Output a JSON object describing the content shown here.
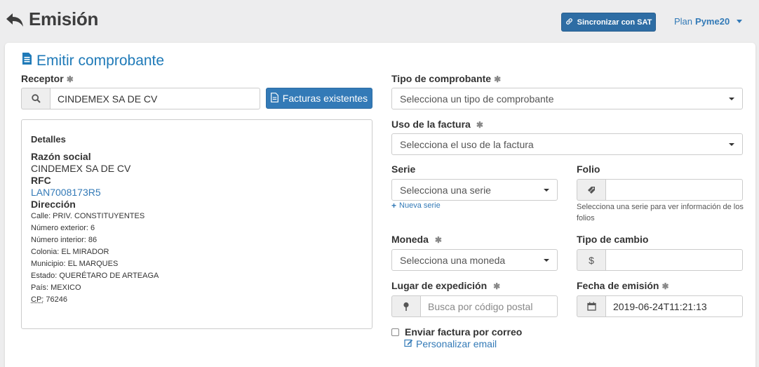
{
  "header": {
    "title": "Emisión",
    "sync_button": "Sincronizar con SAT",
    "plan_label": "Plan",
    "plan_name": "Pyme20"
  },
  "form": {
    "title": "Emitir comprobante",
    "receptor": {
      "label": "Receptor",
      "value": "CINDEMEX SA DE CV",
      "facturas_button": "Facturas existentes"
    },
    "details": {
      "title": "Detalles",
      "razon_label": "Razón social",
      "razon_value": "CINDEMEX SA DE CV",
      "rfc_label": "RFC",
      "rfc_value": "LAN7008173R5",
      "direccion_label": "Dirección",
      "lines": [
        "Calle: PRIV. CONSTITUYENTES",
        "Número exterior: 6",
        "Número interior: 86",
        "Colonia: EL MIRADOR",
        "Municipio: EL MARQUES",
        "Estado: QUERÉTARO DE ARTEAGA",
        "País: MEXICO"
      ],
      "cp_label": "CP:",
      "cp_value": "76246"
    },
    "tipo": {
      "label": "Tipo de comprobante",
      "placeholder": "Selecciona un tipo de comprobante"
    },
    "uso": {
      "label": "Uso de la factura",
      "placeholder": "Selecciona el uso de la factura"
    },
    "serie": {
      "label": "Serie",
      "placeholder": "Selecciona una serie",
      "new_link": "Nueva serie"
    },
    "folio": {
      "label": "Folio",
      "value": "",
      "help": "Selecciona una serie para ver información de los folios"
    },
    "moneda": {
      "label": "Moneda",
      "placeholder": "Selecciona una moneda"
    },
    "tipo_cambio": {
      "label": "Tipo de cambio",
      "addon": "$",
      "value": ""
    },
    "lugar": {
      "label": "Lugar de expedición",
      "placeholder": "Busca por código postal"
    },
    "fecha": {
      "label": "Fecha de emisión",
      "value": "2019-06-24T11:21:13"
    },
    "email": {
      "checkbox_label": "Enviar factura por correo",
      "custom_link": "Personalizar email"
    }
  },
  "colors": {
    "primary": "#337ab7",
    "title_blue": "#1f7ab8",
    "background": "#ededee"
  },
  "icons": {
    "back": "back-arrow-icon",
    "link": "link-icon",
    "document": "document-icon",
    "search": "search-icon",
    "file": "file-icon",
    "tag": "tag-icon",
    "map_marker": "map-marker-icon",
    "calendar": "calendar-icon",
    "edit": "edit-icon"
  }
}
